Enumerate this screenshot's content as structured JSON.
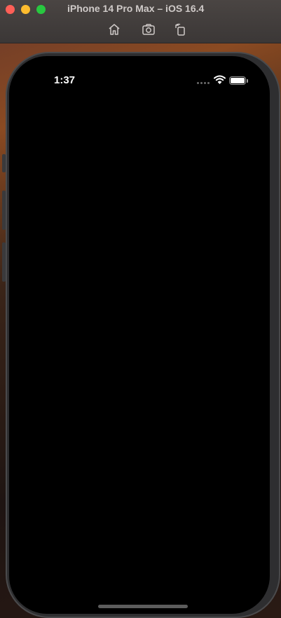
{
  "window": {
    "title": "iPhone 14 Pro Max – iOS 16.4"
  },
  "toolbar": {
    "icons": [
      "home-icon",
      "screenshot-icon",
      "rotate-icon"
    ]
  },
  "status_bar": {
    "time": "1:37",
    "icons": [
      "cellular-dots-icon",
      "wifi-icon",
      "battery-icon"
    ],
    "battery_level": 1.0
  },
  "colors": {
    "close": "#ff5f57",
    "minimize": "#febc2e",
    "maximize": "#28c840",
    "screen_background": "#000000"
  }
}
